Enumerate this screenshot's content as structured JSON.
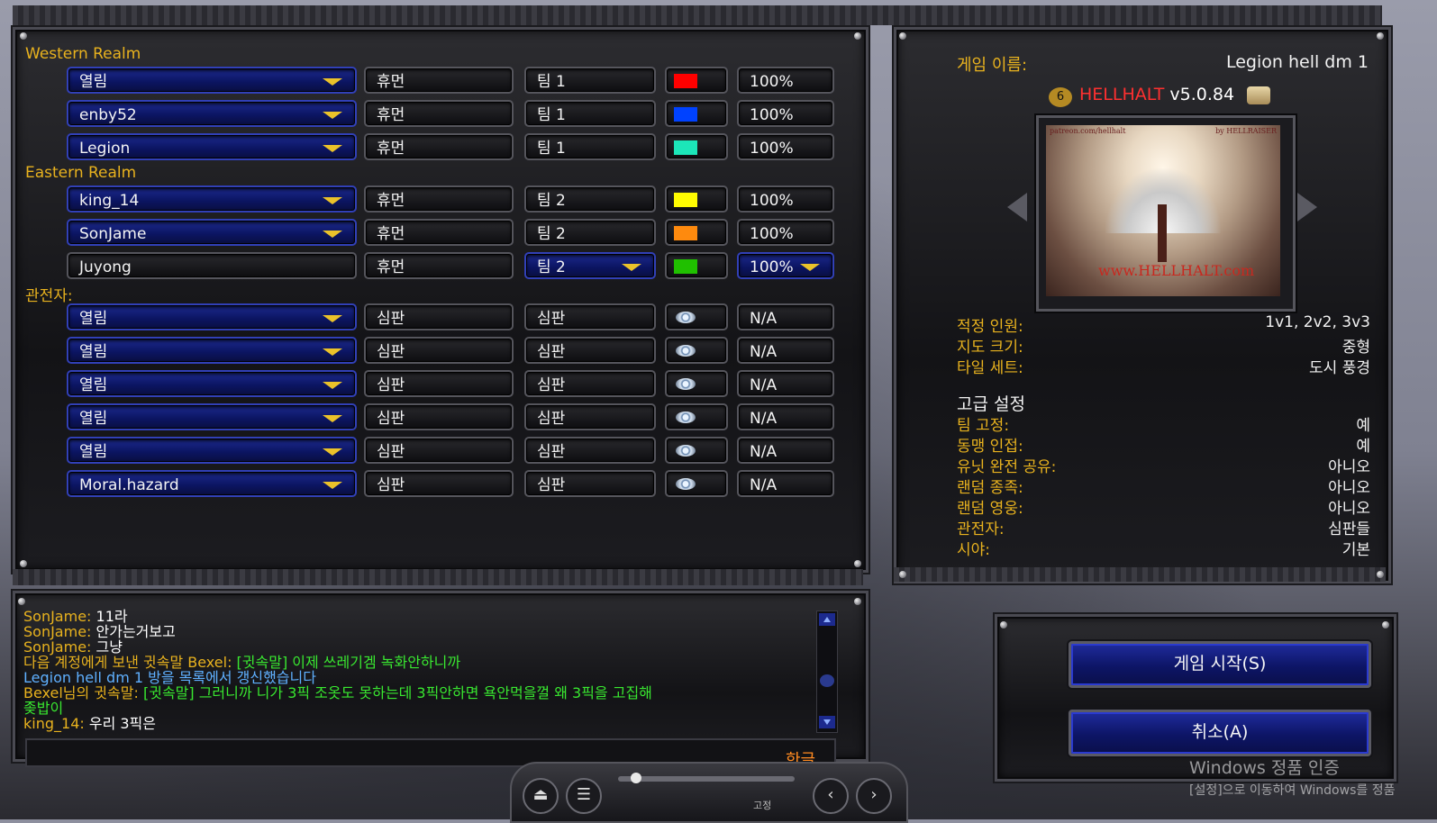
{
  "teams": [
    {
      "header": "Western Realm",
      "players": [
        {
          "name": "열림",
          "race": "휴먼",
          "team": "팀 1",
          "color": "#ff0000",
          "handicap": "100%",
          "editable": false
        },
        {
          "name": "enby52",
          "race": "휴먼",
          "team": "팀 1",
          "color": "#0042ff",
          "handicap": "100%",
          "editable": false
        },
        {
          "name": "Legion",
          "race": "휴먼",
          "team": "팀 1",
          "color": "#1ce6b9",
          "handicap": "100%",
          "editable": false
        }
      ]
    },
    {
      "header": "Eastern Realm",
      "players": [
        {
          "name": "king_14",
          "race": "휴먼",
          "team": "팀 2",
          "color": "#fffc01",
          "handicap": "100%",
          "editable": false
        },
        {
          "name": "SonJame",
          "race": "휴먼",
          "team": "팀 2",
          "color": "#fe8a0e",
          "handicap": "100%",
          "editable": false
        },
        {
          "name": "Juyong",
          "race": "휴먼",
          "team": "팀 2",
          "color": "#20c000",
          "handicap": "100%",
          "editable": true
        }
      ]
    }
  ],
  "observers": {
    "header": "관전자:",
    "players": [
      {
        "name": "열림",
        "race": "심판",
        "team": "심판",
        "handicap": "N/A"
      },
      {
        "name": "열림",
        "race": "심판",
        "team": "심판",
        "handicap": "N/A"
      },
      {
        "name": "열림",
        "race": "심판",
        "team": "심판",
        "handicap": "N/A"
      },
      {
        "name": "열림",
        "race": "심판",
        "team": "심판",
        "handicap": "N/A"
      },
      {
        "name": "열림",
        "race": "심판",
        "team": "심판",
        "handicap": "N/A"
      },
      {
        "name": "Moral.hazard",
        "race": "심판",
        "team": "심판",
        "handicap": "N/A"
      }
    ]
  },
  "game_info": {
    "name_label": "게임 이름:",
    "name_value": "Legion hell dm 1",
    "map_title": "HELLHALT",
    "map_version": "v5.0.84",
    "map_badge": "6",
    "preview_top_left": "patreon.com/hellhalt",
    "preview_top_right": "by HELLRAISER",
    "preview_logo": "www.HELLHALT.com",
    "details": [
      {
        "label": "적정 인원:",
        "value": "1v1, 2v2, 3v3"
      },
      {
        "label": "지도 크기:",
        "value": "중형"
      },
      {
        "label": "타일 세트:",
        "value": "도시 풍경"
      }
    ],
    "advanced_header": "고급 설정",
    "advanced": [
      {
        "label": "팀 고정:",
        "value": "예"
      },
      {
        "label": "동맹 인접:",
        "value": "예"
      },
      {
        "label": "유닛 완전 공유:",
        "value": "아니오"
      },
      {
        "label": "랜덤 종족:",
        "value": "아니오"
      },
      {
        "label": "랜덤 영웅:",
        "value": "아니오"
      },
      {
        "label": "관전자:",
        "value": "심판들"
      },
      {
        "label": "시야:",
        "value": "기본"
      }
    ]
  },
  "chat": [
    {
      "speaker": "SonJame:",
      "text": " 11라",
      "speaker_color": "#e8b21e",
      "text_color": "#ffffff"
    },
    {
      "speaker": "SonJame:",
      "text": " 안가는거보고",
      "speaker_color": "#e8b21e",
      "text_color": "#ffffff"
    },
    {
      "speaker": "SonJame:",
      "text": " 그냥",
      "speaker_color": "#e8b21e",
      "text_color": "#ffffff"
    },
    {
      "speaker": "다음 계정에게 보낸 귓속말 Bexel:",
      "text": " [귓속말] 이제 쓰레기겜 녹화안하니까",
      "speaker_color": "#e8b21e",
      "text_color": "#39e830"
    },
    {
      "speaker": "",
      "text": "Legion hell dm 1 방을 목록에서 갱신했습니다",
      "speaker_color": "#e8b21e",
      "text_color": "#5fb0ff"
    },
    {
      "speaker": "Bexel님의 귓속말:",
      "text": " [귓속말] 그러니까 니가 3픽 조옷도 못하는데 3픽안하면 욕안먹을껄 왜 3픽을 고집해",
      "speaker_color": "#e8b21e",
      "text_color": "#39e830"
    },
    {
      "speaker": "",
      "text": "좆밥이",
      "speaker_color": "#e8b21e",
      "text_color": "#39e830"
    },
    {
      "speaker": "king_14:",
      "text": " 우리 3픽은",
      "speaker_color": "#e8b21e",
      "text_color": "#ffffff"
    }
  ],
  "chat_input": {
    "lang_indicator": "한글"
  },
  "buttons": {
    "start": "게임 시작(S)",
    "cancel": "취소(A)"
  },
  "taskbar": {
    "lock_label": "고정"
  },
  "watermark": {
    "line1": "Windows 정품 인증",
    "line2": "[설정]으로 이동하여 Windows를 정품"
  },
  "icons": {
    "dropdown": "chevron-down-icon",
    "observer": "eye-icon",
    "scroll_up": "arrow-up-icon",
    "scroll_down": "arrow-down-icon",
    "eject": "eject-icon",
    "menu": "menu-icon",
    "prev": "chevron-left-icon",
    "next": "chevron-right-icon"
  }
}
